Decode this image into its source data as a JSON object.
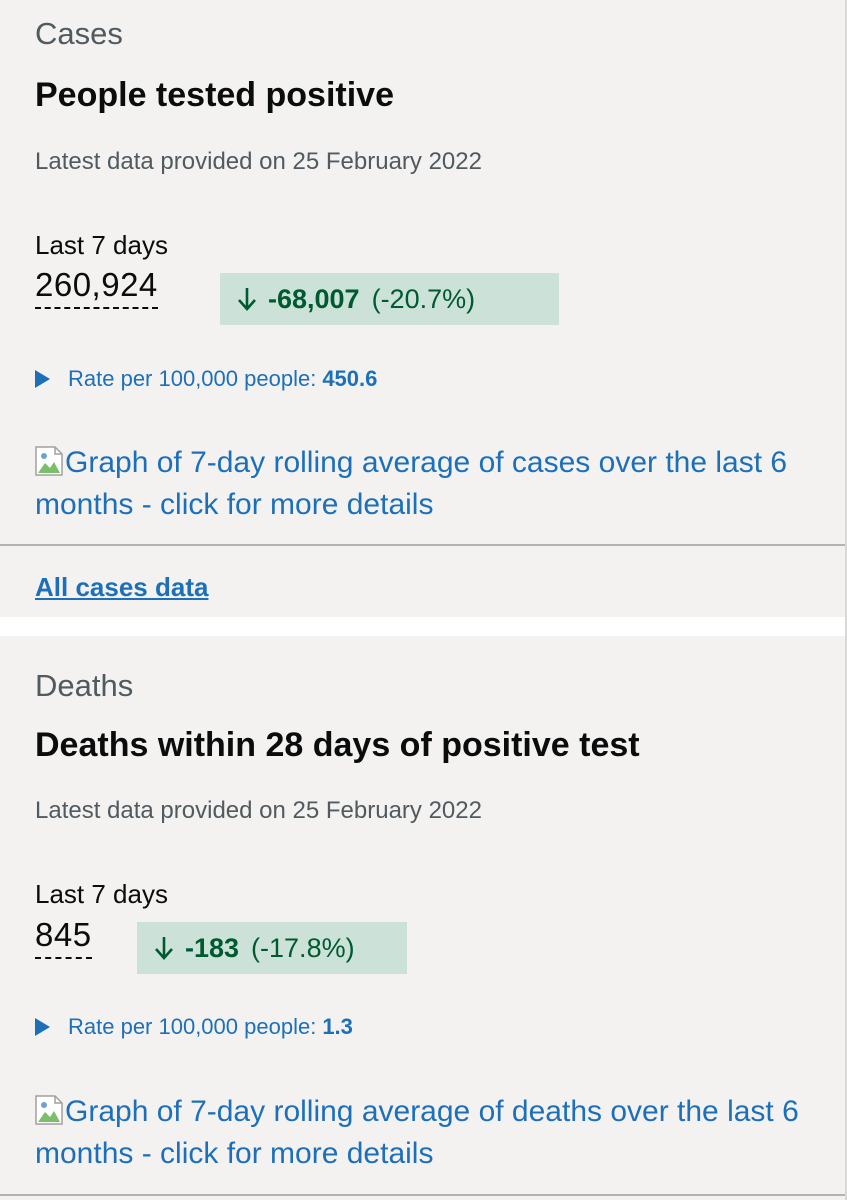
{
  "cases": {
    "category": "Cases",
    "heading": "People tested positive",
    "date_line": "Latest data provided on 25 February 2022",
    "period_label": "Last 7 days",
    "value": "260,924",
    "change": {
      "direction": "down",
      "delta": "-68,007",
      "percent": "(-20.7%)"
    },
    "rate_label": "Rate per 100,000 people:",
    "rate_value": "450.6",
    "graph_alt": "Graph of 7-day rolling average of cases over the last 6 months - click for more details",
    "all_data_link": "All cases data"
  },
  "deaths": {
    "category": "Deaths",
    "heading": "Deaths within 28 days of positive test",
    "date_line": "Latest data provided on 25 February 2022",
    "period_label": "Last 7 days",
    "value": "845",
    "change": {
      "direction": "down",
      "delta": "-183",
      "percent": "(-17.8%)"
    },
    "rate_label": "Rate per 100,000 people:",
    "rate_value": "1.3",
    "graph_alt": "Graph of 7-day rolling average of deaths over the last 6 months - click for more details"
  },
  "colors": {
    "card_background": "#f3f2f1",
    "link_blue": "#1d70b8",
    "change_background": "#cce2d8",
    "change_text": "#005a30",
    "secondary_text": "#505a5f"
  },
  "icons": {
    "change_arrow": "arrow-down-icon",
    "details_toggle": "triangle-right-icon",
    "graph_placeholder": "broken-image-icon"
  }
}
